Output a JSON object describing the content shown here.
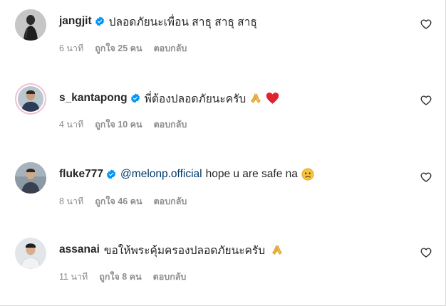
{
  "comments": [
    {
      "username": "jangjit",
      "verified": true,
      "mention": "",
      "text": "ปลอดภัยนะเพื่อน สาธุ สาธุ สาธุ",
      "emojis": [],
      "time": "6 นาที",
      "likes": "ถูกใจ 25 คน",
      "reply": "ตอบกลับ"
    },
    {
      "username": "s_kantapong",
      "verified": true,
      "mention": "",
      "text": "พี่ต้องปลอดภัยนะครับ",
      "emojis": [
        "folded-hands-emoji",
        "red-heart-emoji"
      ],
      "time": "4 นาที",
      "likes": "ถูกใจ 10 คน",
      "reply": "ตอบกลับ"
    },
    {
      "username": "fluke777",
      "verified": true,
      "mention": "@melonp.official",
      "text": "hope u are safe na",
      "emojis": [
        "worried-face-emoji"
      ],
      "time": "8 นาที",
      "likes": "ถูกใจ 46 คน",
      "reply": "ตอบกลับ"
    },
    {
      "username": "assanai",
      "verified": false,
      "mention": "",
      "text": "ขอให้พระคุ้มครองปลอดภัยนะครับ",
      "emojis": [
        "folded-hands-emoji"
      ],
      "time": "11 นาที",
      "likes": "ถูกใจ 8 คน",
      "reply": "ตอบกลับ"
    }
  ],
  "colors": {
    "text": "#262626",
    "meta": "#8e8e8e",
    "mention": "#00376b",
    "verified": "#0095f6",
    "story_ring": "#f2c0d6"
  },
  "icons": {
    "verified": "verified-badge-icon",
    "like": "heart-outline-icon"
  }
}
